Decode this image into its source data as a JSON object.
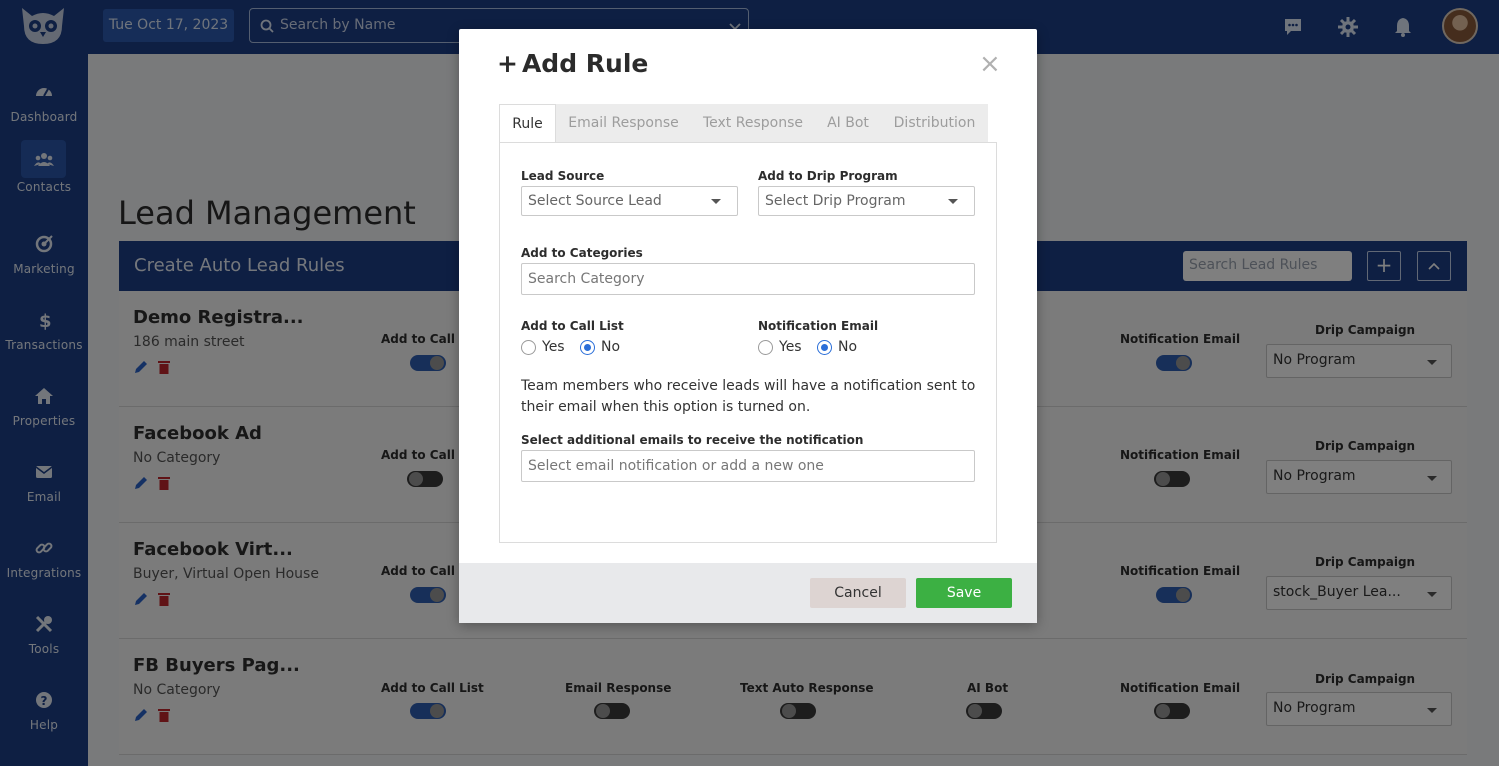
{
  "topbar": {
    "date": "Tue Oct 17, 2023",
    "search_placeholder": "Search by Name"
  },
  "sidebar": {
    "items": [
      {
        "label": "Dashboard",
        "icon": "dashboard-icon"
      },
      {
        "label": "Contacts",
        "icon": "contacts-icon",
        "active": true
      },
      {
        "label": "Marketing",
        "icon": "marketing-icon"
      },
      {
        "label": "Transactions",
        "icon": "dollar-icon"
      },
      {
        "label": "Properties",
        "icon": "home-icon"
      },
      {
        "label": "Email",
        "icon": "envelope-icon"
      },
      {
        "label": "Integrations",
        "icon": "link-icon"
      },
      {
        "label": "Tools",
        "icon": "tools-icon"
      },
      {
        "label": "Help",
        "icon": "help-icon"
      }
    ]
  },
  "page": {
    "title": "Lead Management",
    "bar_title": "Create Auto Lead Rules",
    "search_placeholder": "Search Lead Rules",
    "add_symbol": "+",
    "collapse_symbol": "^"
  },
  "columns": {
    "call_list": "Add to Call List",
    "email_response": "Email Response",
    "text_response": "Text Auto Response",
    "ai_bot": "AI Bot",
    "notification_email": "Notification Email",
    "drip_campaign": "Drip Campaign"
  },
  "rules": [
    {
      "name": "Demo Registra...",
      "sub": "186 main street",
      "call_list_on": true,
      "notif_on": true,
      "drip": "No Program"
    },
    {
      "name": "Facebook Ad",
      "sub": "No Category",
      "call_list_on": false,
      "notif_on": false,
      "drip": "No Program"
    },
    {
      "name": "Facebook Virt...",
      "sub": "Buyer, Virtual Open House",
      "call_list_on": true,
      "notif_on": true,
      "drip": "stock_Buyer Lea..."
    },
    {
      "name": "FB Buyers Pag...",
      "sub": "No Category",
      "call_list_on": true,
      "email_on": false,
      "text_on": false,
      "ai_on": false,
      "notif_on": false,
      "drip": "No Program"
    }
  ],
  "modal": {
    "title": "Add Rule",
    "plus": "+",
    "close": "×",
    "tabs": [
      "Rule",
      "Email Response",
      "Text Response",
      "AI Bot",
      "Distribution"
    ],
    "lead_source_label": "Lead Source",
    "lead_source_placeholder": "Select Source Lead",
    "drip_label": "Add to Drip Program",
    "drip_placeholder": "Select Drip Program",
    "categories_label": "Add to Categories",
    "categories_placeholder": "Search Category",
    "call_list_label": "Add to Call List",
    "notification_label": "Notification Email",
    "yes": "Yes",
    "no": "No",
    "call_list_value": "No",
    "notification_value": "No",
    "help_text": "Team members who receive leads will have a notification sent to their email when this option is turned on.",
    "additional_emails_label": "Select additional emails to receive the notification",
    "additional_emails_placeholder": "Select email notification or add a new one",
    "cancel": "Cancel",
    "save": "Save"
  }
}
